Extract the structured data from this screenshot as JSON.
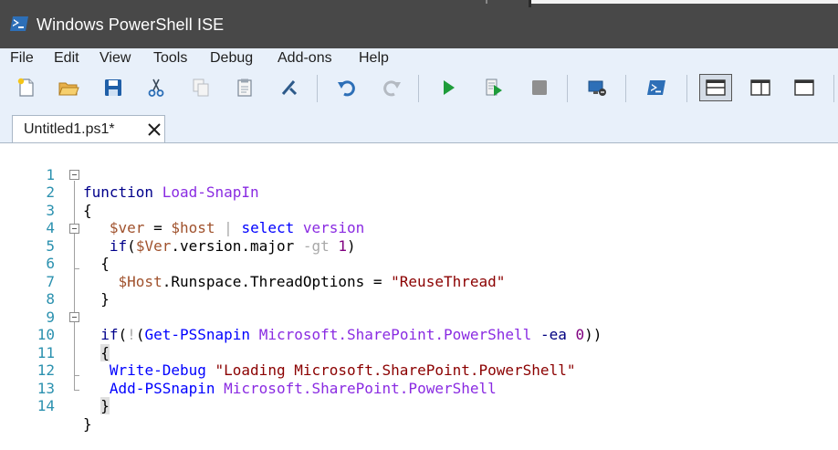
{
  "window": {
    "title": "Windows PowerShell ISE",
    "icon": "powershell-icon"
  },
  "menu": [
    "File",
    "Edit",
    "View",
    "Tools",
    "Debug",
    "Add-ons",
    "Help"
  ],
  "toolbar": {
    "buttons": [
      "new-icon",
      "open-icon",
      "save-icon",
      "cut-icon",
      "copy-icon",
      "paste-icon",
      "clear-console-icon",
      "undo-icon",
      "redo-icon",
      "run-icon",
      "run-selection-icon",
      "stop-icon",
      "remote-session-icon",
      "powershell-console-icon",
      "layout-top-icon",
      "layout-right-icon",
      "layout-max-icon"
    ]
  },
  "tab": {
    "label": "Untitled1.ps1*"
  },
  "editor": {
    "line_numbers": [
      "1",
      "2",
      "3",
      "4",
      "5",
      "6",
      "7",
      "8",
      "9",
      "10",
      "11",
      "12",
      "13",
      "14"
    ]
  },
  "colors": {
    "titlebar": "#484848",
    "chrome": "#e8f0fa",
    "line_number": "#2b91af",
    "keyword": "#00008b",
    "command": "#0000ff",
    "variable": "#a0522d",
    "argument": "#8a2be2",
    "string": "#8b0000"
  }
}
